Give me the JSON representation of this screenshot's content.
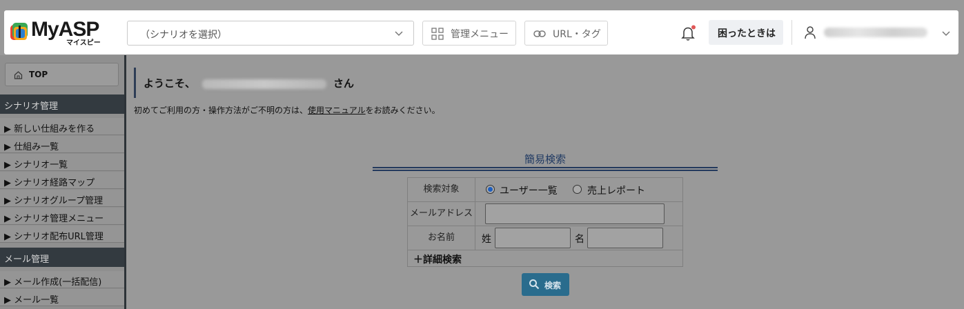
{
  "header": {
    "logo_text": "MyASP",
    "logo_sub": "マイスピー",
    "scenario_placeholder": "（シナリオを選択）",
    "menu_label": "管理メニュー",
    "url_label": "URL・タグ",
    "help_label": "困ったときは"
  },
  "sidebar": {
    "top_label": "TOP",
    "sections": [
      {
        "title": "シナリオ管理",
        "items": [
          "▶ 新しい仕組みを作る",
          "▶ 仕組み一覧",
          "▶ シナリオ一覧",
          "▶ シナリオ経路マップ",
          "▶ シナリオグループ管理",
          "▶ シナリオ管理メニュー",
          "▶ シナリオ配布URL管理"
        ]
      },
      {
        "title": "メール管理",
        "items": [
          "▶ メール作成(一括配信)",
          "▶ メール一覧"
        ]
      }
    ]
  },
  "main": {
    "welcome_prefix": "ようこそ、",
    "welcome_suffix": "さん",
    "intro_before": "初めてご利用の方・操作方法がご不明の方は、",
    "intro_link": "使用マニュアル",
    "intro_after": "をお読みください。"
  },
  "search": {
    "title": "簡易検索",
    "target_label": "検索対象",
    "option_users": "ユーザー一覧",
    "option_sales": "売上レポート",
    "email_label": "メールアドレス",
    "name_label": "お名前",
    "last_name": "姓",
    "first_name": "名",
    "detail_label": "＋詳細検索",
    "button_label": "検索"
  },
  "colors": {
    "brand_dark": "#2d3d56",
    "search_button": "#2a6c8d",
    "notification_dot": "#e05757"
  }
}
